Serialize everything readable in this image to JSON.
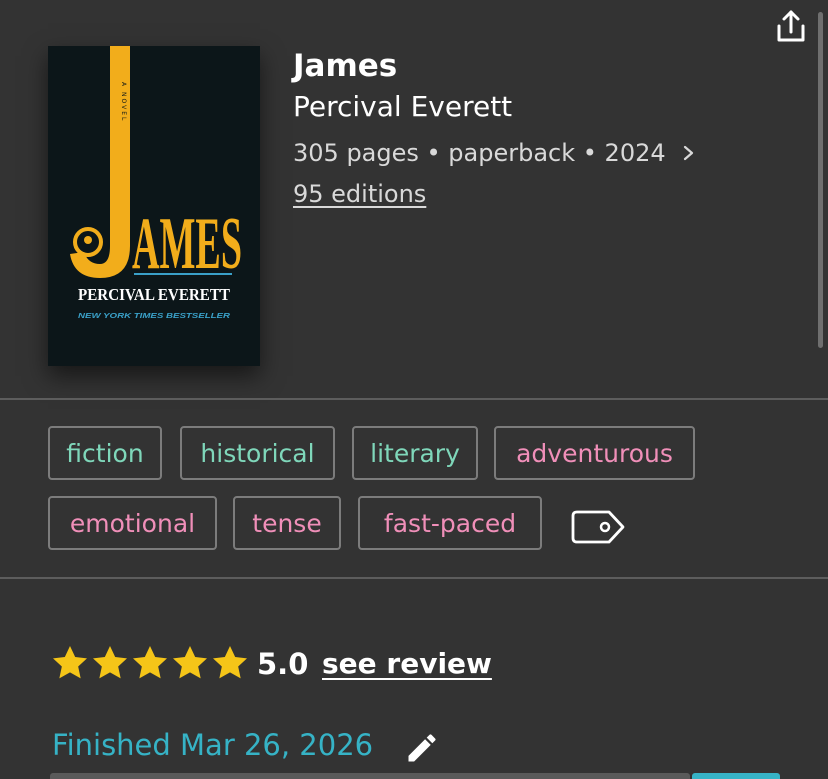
{
  "book": {
    "title": "James",
    "author": "Percival Everett",
    "details": "305 pages • paperback • 2024",
    "editions_label": "95 editions"
  },
  "cover": {
    "title_text": "JAMES",
    "author_text": "PERCIVAL EVERETT",
    "badge_text": "NEW YORK TIMES BESTSELLER",
    "spine_text": "A NOVEL",
    "colors": {
      "background": "#0c1619",
      "accent": "#f2ad1b",
      "badge": "#3aa0c8"
    }
  },
  "tags": {
    "items": [
      {
        "label": "fiction",
        "color": "green"
      },
      {
        "label": "historical",
        "color": "green"
      },
      {
        "label": "literary",
        "color": "green"
      },
      {
        "label": "adventurous",
        "color": "pink"
      },
      {
        "label": "emotional",
        "color": "pink"
      },
      {
        "label": "tense",
        "color": "pink"
      },
      {
        "label": "fast-paced",
        "color": "pink"
      }
    ]
  },
  "review": {
    "stars": 5,
    "rating": "5.0",
    "see_review_label": "see review"
  },
  "status": {
    "finished_label": "Finished Mar 26, 2026"
  },
  "icons": {
    "share": "share-icon",
    "chevron": "chevron-right-icon",
    "tag": "tag-icon",
    "star": "star-icon",
    "edit": "pencil-icon"
  },
  "colors": {
    "background": "#333333",
    "divider": "#5d5d5d",
    "tag_green": "#7fd7ba",
    "tag_pink": "#f08fb9",
    "star": "#f5c518",
    "finished": "#36b3c6"
  }
}
